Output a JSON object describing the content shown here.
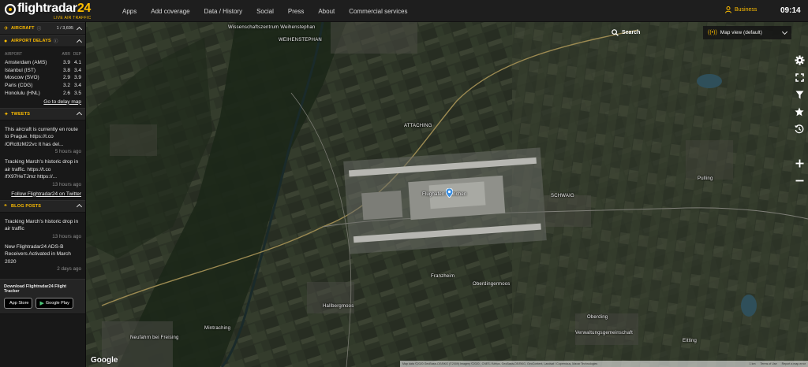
{
  "brand": {
    "name": "flightradar",
    "number": "24",
    "tagline": "LIVE AIR TRAFFIC"
  },
  "nav": [
    "Apps",
    "Add coverage",
    "Data / History",
    "Social",
    "Press",
    "About",
    "Commercial services"
  ],
  "account": {
    "label": "Business"
  },
  "clock": "09:14",
  "sidebar": {
    "aircraft": {
      "title": "AIRCRAFT",
      "count": "1 / 3,695"
    },
    "delays": {
      "title": "AIRPORT DELAYS",
      "headers": {
        "airport": "AIRPORT",
        "arr": "ARR",
        "dep": "DEP"
      },
      "rows": [
        {
          "airport": "Amsterdam (AMS)",
          "arr": "3.9",
          "dep": "4.1"
        },
        {
          "airport": "Istanbul (IST)",
          "arr": "3.8",
          "dep": "3.4"
        },
        {
          "airport": "Moscow (SVO)",
          "arr": "2.9",
          "dep": "3.9"
        },
        {
          "airport": "Paris (CDG)",
          "arr": "3.2",
          "dep": "3.4"
        },
        {
          "airport": "Honolulu (HNL)",
          "arr": "2.6",
          "dep": "3.5"
        }
      ],
      "link": "Go to delay map"
    },
    "tweets": {
      "title": "TWEETS",
      "items": [
        {
          "text": "This aircraft is currently en route to Prague. https://t.co /ORc8zM22vc It has del...",
          "time": "5 hours ago"
        },
        {
          "text": "Tracking March's historic drop in air traffic. https://t.co /fX97HeTJmz https://...",
          "time": "13 hours ago"
        }
      ],
      "link": "Follow Flightradar24 on Twitter"
    },
    "blog": {
      "title": "BLOG POSTS",
      "items": [
        {
          "text": "Tracking March's historic drop in air traffic",
          "time": "13 hours ago"
        },
        {
          "text": "New Flightradar24 ADS-B Receivers Activated in March 2020",
          "time": "2 days ago"
        }
      ]
    },
    "download": {
      "title": "Download Flightradar24 Flight Tracker",
      "appstore": "App Store",
      "googleplay": "Google Play"
    }
  },
  "map": {
    "search_label": "Search",
    "map_view_label": "Map view (default)",
    "labels": [
      "Wissenschaftszentrum Weihenstephan",
      "WEIHENSTEPHAN",
      "ATTACHING",
      "Flughafen München",
      "SCHWAIG",
      "Hallbergmoos",
      "Franzheim",
      "Oberding",
      "Oberdingermoos",
      "Neufahrn bei Freising",
      "Mintraching",
      "Eitting",
      "Verwaltungsgemeinschaft",
      "Pulling"
    ],
    "google": "Google",
    "attribution": "Map data ©2020 GeoBasis-DE/BKG (©2009) Imagery ©2020 , CNES / Airbus, GeoBasis-DE/BKG, GeoContent, Landsat / Copernicus, Maxar Technologies",
    "scale": "1 km",
    "terms": "Terms of Use",
    "report": "Report a map error"
  },
  "colors": {
    "accent": "#ffbe00",
    "topbar": "#1e1e1e",
    "sidebar": "#181818"
  }
}
